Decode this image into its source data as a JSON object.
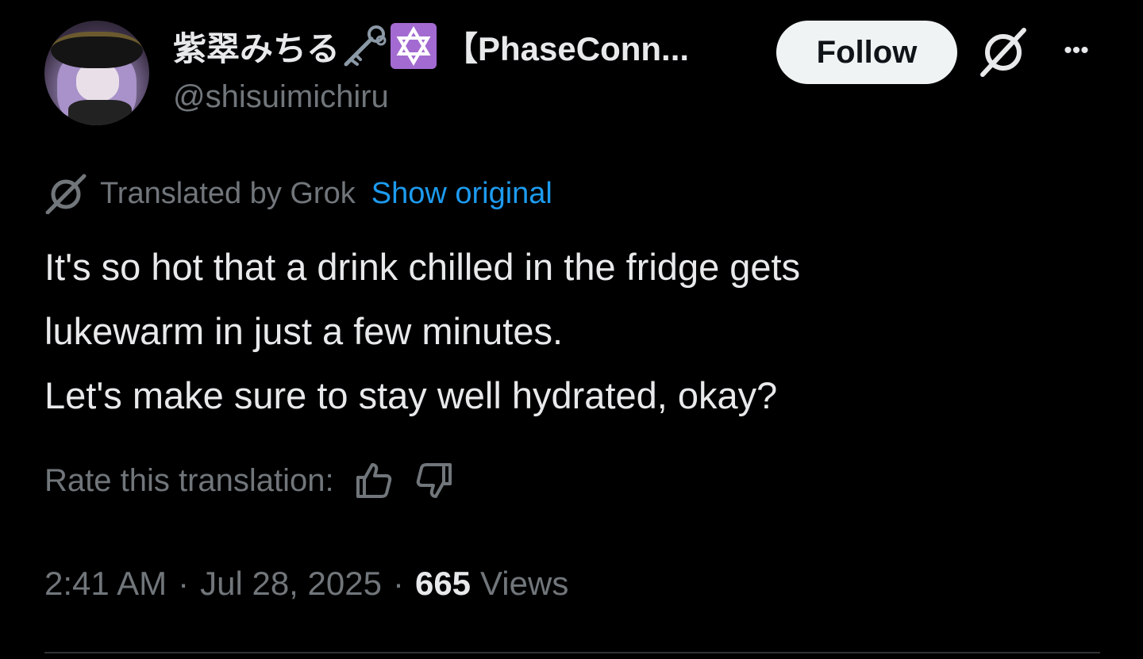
{
  "author": {
    "display_name": "紫翠みちる",
    "name_suffix": "【PhaseConn...",
    "handle": "@shisuimichiru",
    "avatar_icon": "anime-character-avatar",
    "badge_icons": [
      "key-icon",
      "star-of-david-badge-icon"
    ]
  },
  "header": {
    "follow_label": "Follow",
    "grok_icon": "grok-icon",
    "more_label": "•••"
  },
  "translation": {
    "translated_by": "Translated by Grok",
    "show_original": "Show original"
  },
  "tweet": {
    "lines": [
      "It's so hot that a drink chilled in the fridge gets",
      "lukewarm in just a few minutes.",
      "Let's make sure to stay well hydrated, okay?"
    ]
  },
  "rating": {
    "label": "Rate this translation:",
    "thumbs_up_icon": "thumbs-up-icon",
    "thumbs_down_icon": "thumbs-down-icon"
  },
  "meta": {
    "time": "2:41 AM",
    "separator": "·",
    "date": "Jul 28, 2025",
    "views_count": "665",
    "views_label": "Views"
  },
  "colors": {
    "background": "#000000",
    "primary_text": "#e7e9ea",
    "secondary_text": "#71767b",
    "link": "#1d9bf0",
    "follow_bg": "#eff3f4",
    "badge_purple": "#a36bd1"
  }
}
